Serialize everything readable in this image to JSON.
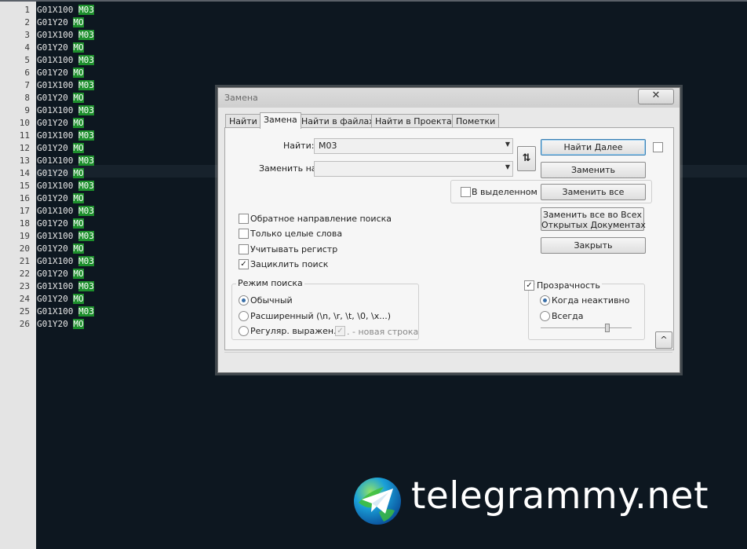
{
  "editor": {
    "lines": [
      {
        "num": "1",
        "code": "G01X100 ",
        "hl": "M03"
      },
      {
        "num": "2",
        "code": "G01Y20 ",
        "hl": "MO"
      },
      {
        "num": "3",
        "code": "G01X100 ",
        "hl": "M03"
      },
      {
        "num": "4",
        "code": "G01Y20 ",
        "hl": "MO"
      },
      {
        "num": "5",
        "code": "G01X100 ",
        "hl": "M03"
      },
      {
        "num": "6",
        "code": "G01Y20 ",
        "hl": "MO"
      },
      {
        "num": "7",
        "code": "G01X100 ",
        "hl": "M03"
      },
      {
        "num": "8",
        "code": "G01Y20 ",
        "hl": "MO"
      },
      {
        "num": "9",
        "code": "G01X100 ",
        "hl": "M03"
      },
      {
        "num": "10",
        "code": "G01Y20 ",
        "hl": "MO"
      },
      {
        "num": "11",
        "code": "G01X100 ",
        "hl": "M03"
      },
      {
        "num": "12",
        "code": "G01Y20 ",
        "hl": "MO"
      },
      {
        "num": "13",
        "code": "G01X100 ",
        "hl": "M03"
      },
      {
        "num": "14",
        "code": "G01Y20 ",
        "hl": "MO"
      },
      {
        "num": "15",
        "code": "G01X100 ",
        "hl": "M03"
      },
      {
        "num": "16",
        "code": "G01Y20 ",
        "hl": "MO"
      },
      {
        "num": "17",
        "code": "G01X100 ",
        "hl": "M03"
      },
      {
        "num": "18",
        "code": "G01Y20 ",
        "hl": "MO"
      },
      {
        "num": "19",
        "code": "G01X100 ",
        "hl": "M03"
      },
      {
        "num": "20",
        "code": "G01Y20 ",
        "hl": "MO"
      },
      {
        "num": "21",
        "code": "G01X100 ",
        "hl": "M03"
      },
      {
        "num": "22",
        "code": "G01Y20 ",
        "hl": "MO"
      },
      {
        "num": "23",
        "code": "G01X100 ",
        "hl": "M03"
      },
      {
        "num": "24",
        "code": "G01Y20 ",
        "hl": "MO"
      },
      {
        "num": "25",
        "code": "G01X100 ",
        "hl": "M03"
      },
      {
        "num": "26",
        "code": "G01Y20 ",
        "hl": "MO"
      }
    ],
    "code_highlight_mode": "plain-with-green-matches",
    "highlight_color": "#1d8f2c"
  },
  "dialog": {
    "title": "Замена",
    "close_icon": "close-icon",
    "tabs": [
      "Найти",
      "Замена",
      "Найти в файлах",
      "Найти в Проектах",
      "Пометки"
    ],
    "active_tab": "Замена",
    "find_label": "Найти:",
    "find_value": "M03",
    "replace_label": "Заменить на:",
    "replace_value": "",
    "swap_icon": "swap-arrows-icon",
    "swap_glyph": "⇅",
    "in_selection_label": "В выделенном",
    "in_selection_checked": false,
    "buttons": {
      "find_next": "Найти Далее",
      "replace": "Заменить",
      "replace_all": "Заменить все",
      "replace_all_open_line1": "Заменить все во Всех",
      "replace_all_open_line2": "Открытых Документах",
      "close": "Закрыть"
    },
    "options": [
      {
        "label": "Обратное направление поиска",
        "checked": false
      },
      {
        "label": "Только целые слова",
        "checked": false
      },
      {
        "label": "Учитывать регистр",
        "checked": false
      },
      {
        "label": "Зациклить поиск",
        "checked": true
      }
    ],
    "search_mode": {
      "legend": "Режим поиска",
      "normal": "Обычный",
      "extended": "Расширенный (\\n, \\r, \\t, \\0, \\x...)",
      "regex": "Регуляр. выражен.",
      "newline_label": ". - новая строка",
      "selected": "Обычный"
    },
    "transparency": {
      "label": "Прозрачность",
      "checked": true,
      "on_inactive": "Когда неактивно",
      "always": "Всегда",
      "selected": "Когда неактивно",
      "level": 0.72
    },
    "collapse_glyph": "^",
    "collapse_icon": "collapse-up-icon"
  },
  "watermark": {
    "text": "telegrammy.net",
    "logo_icon": "telegram-globe-icon"
  }
}
